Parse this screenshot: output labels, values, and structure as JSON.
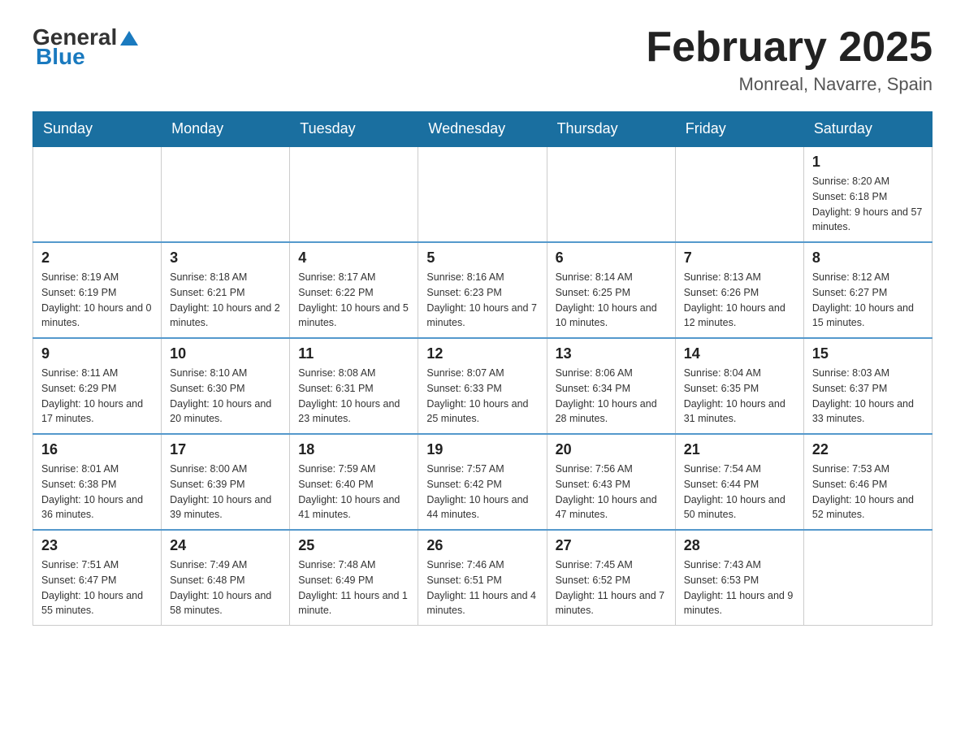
{
  "header": {
    "logo_general": "General",
    "logo_blue": "Blue",
    "month_title": "February 2025",
    "location": "Monreal, Navarre, Spain"
  },
  "weekdays": [
    "Sunday",
    "Monday",
    "Tuesday",
    "Wednesday",
    "Thursday",
    "Friday",
    "Saturday"
  ],
  "weeks": [
    [
      {
        "day": "",
        "info": ""
      },
      {
        "day": "",
        "info": ""
      },
      {
        "day": "",
        "info": ""
      },
      {
        "day": "",
        "info": ""
      },
      {
        "day": "",
        "info": ""
      },
      {
        "day": "",
        "info": ""
      },
      {
        "day": "1",
        "info": "Sunrise: 8:20 AM\nSunset: 6:18 PM\nDaylight: 9 hours and 57 minutes."
      }
    ],
    [
      {
        "day": "2",
        "info": "Sunrise: 8:19 AM\nSunset: 6:19 PM\nDaylight: 10 hours and 0 minutes."
      },
      {
        "day": "3",
        "info": "Sunrise: 8:18 AM\nSunset: 6:21 PM\nDaylight: 10 hours and 2 minutes."
      },
      {
        "day": "4",
        "info": "Sunrise: 8:17 AM\nSunset: 6:22 PM\nDaylight: 10 hours and 5 minutes."
      },
      {
        "day": "5",
        "info": "Sunrise: 8:16 AM\nSunset: 6:23 PM\nDaylight: 10 hours and 7 minutes."
      },
      {
        "day": "6",
        "info": "Sunrise: 8:14 AM\nSunset: 6:25 PM\nDaylight: 10 hours and 10 minutes."
      },
      {
        "day": "7",
        "info": "Sunrise: 8:13 AM\nSunset: 6:26 PM\nDaylight: 10 hours and 12 minutes."
      },
      {
        "day": "8",
        "info": "Sunrise: 8:12 AM\nSunset: 6:27 PM\nDaylight: 10 hours and 15 minutes."
      }
    ],
    [
      {
        "day": "9",
        "info": "Sunrise: 8:11 AM\nSunset: 6:29 PM\nDaylight: 10 hours and 17 minutes."
      },
      {
        "day": "10",
        "info": "Sunrise: 8:10 AM\nSunset: 6:30 PM\nDaylight: 10 hours and 20 minutes."
      },
      {
        "day": "11",
        "info": "Sunrise: 8:08 AM\nSunset: 6:31 PM\nDaylight: 10 hours and 23 minutes."
      },
      {
        "day": "12",
        "info": "Sunrise: 8:07 AM\nSunset: 6:33 PM\nDaylight: 10 hours and 25 minutes."
      },
      {
        "day": "13",
        "info": "Sunrise: 8:06 AM\nSunset: 6:34 PM\nDaylight: 10 hours and 28 minutes."
      },
      {
        "day": "14",
        "info": "Sunrise: 8:04 AM\nSunset: 6:35 PM\nDaylight: 10 hours and 31 minutes."
      },
      {
        "day": "15",
        "info": "Sunrise: 8:03 AM\nSunset: 6:37 PM\nDaylight: 10 hours and 33 minutes."
      }
    ],
    [
      {
        "day": "16",
        "info": "Sunrise: 8:01 AM\nSunset: 6:38 PM\nDaylight: 10 hours and 36 minutes."
      },
      {
        "day": "17",
        "info": "Sunrise: 8:00 AM\nSunset: 6:39 PM\nDaylight: 10 hours and 39 minutes."
      },
      {
        "day": "18",
        "info": "Sunrise: 7:59 AM\nSunset: 6:40 PM\nDaylight: 10 hours and 41 minutes."
      },
      {
        "day": "19",
        "info": "Sunrise: 7:57 AM\nSunset: 6:42 PM\nDaylight: 10 hours and 44 minutes."
      },
      {
        "day": "20",
        "info": "Sunrise: 7:56 AM\nSunset: 6:43 PM\nDaylight: 10 hours and 47 minutes."
      },
      {
        "day": "21",
        "info": "Sunrise: 7:54 AM\nSunset: 6:44 PM\nDaylight: 10 hours and 50 minutes."
      },
      {
        "day": "22",
        "info": "Sunrise: 7:53 AM\nSunset: 6:46 PM\nDaylight: 10 hours and 52 minutes."
      }
    ],
    [
      {
        "day": "23",
        "info": "Sunrise: 7:51 AM\nSunset: 6:47 PM\nDaylight: 10 hours and 55 minutes."
      },
      {
        "day": "24",
        "info": "Sunrise: 7:49 AM\nSunset: 6:48 PM\nDaylight: 10 hours and 58 minutes."
      },
      {
        "day": "25",
        "info": "Sunrise: 7:48 AM\nSunset: 6:49 PM\nDaylight: 11 hours and 1 minute."
      },
      {
        "day": "26",
        "info": "Sunrise: 7:46 AM\nSunset: 6:51 PM\nDaylight: 11 hours and 4 minutes."
      },
      {
        "day": "27",
        "info": "Sunrise: 7:45 AM\nSunset: 6:52 PM\nDaylight: 11 hours and 7 minutes."
      },
      {
        "day": "28",
        "info": "Sunrise: 7:43 AM\nSunset: 6:53 PM\nDaylight: 11 hours and 9 minutes."
      },
      {
        "day": "",
        "info": ""
      }
    ]
  ]
}
